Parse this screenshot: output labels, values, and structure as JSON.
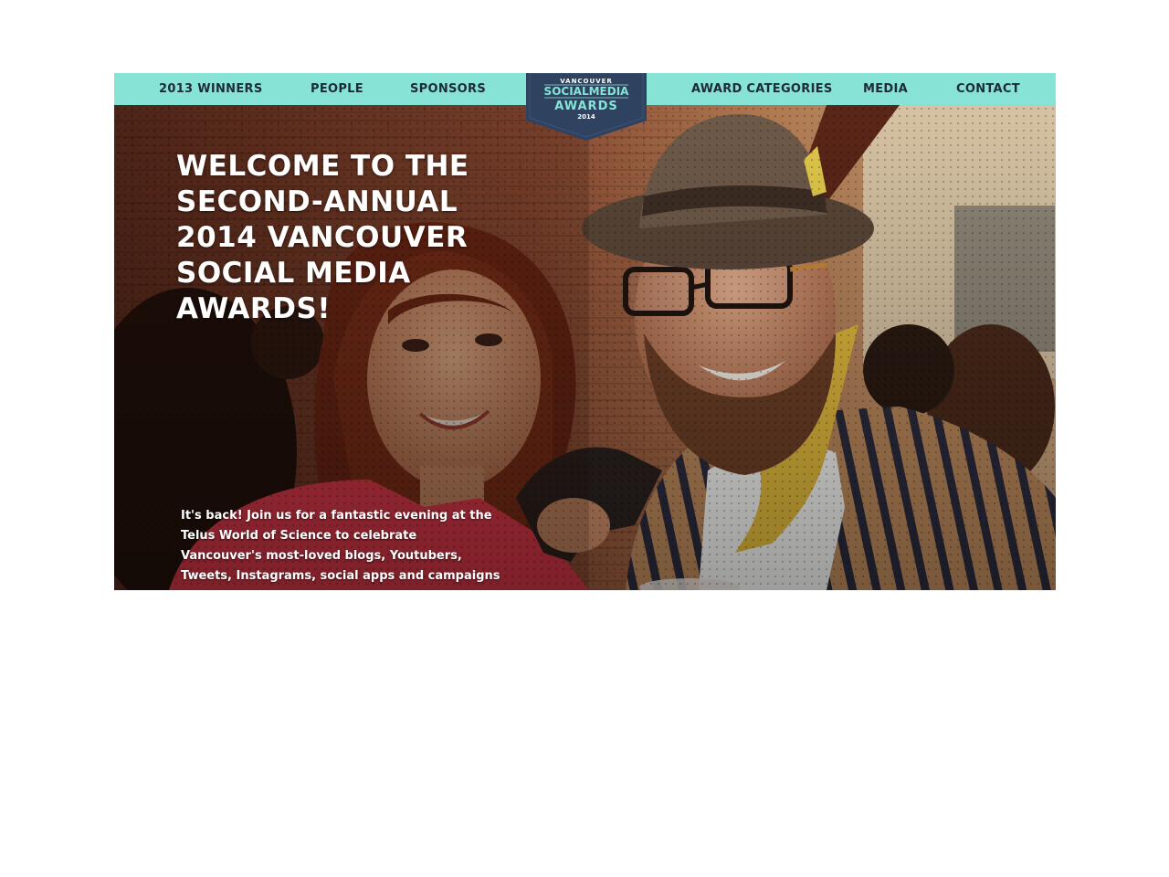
{
  "nav": {
    "left": [
      "2013 WINNERS",
      "PEOPLE",
      "SPONSORS"
    ],
    "right": [
      "AWARD CATEGORIES",
      "MEDIA",
      "CONTACT"
    ]
  },
  "logo": {
    "line1": "VANCOUVER",
    "line2": "SOCIALMEDIA",
    "line3": "AWARDS",
    "line4": "2014"
  },
  "hero": {
    "heading": "WELCOME TO THE SECOND-ANNUAL 2014 VANCOUVER SOCIAL MEDIA AWARDS!",
    "intro": "It's back! Join us for a fantastic evening at the Telus World of Science to celebrate Vancouver's most-loved blogs, Youtubers, Tweets, Instagrams, social apps and campaigns and the creators."
  },
  "colors": {
    "nav_bg": "#86e3d6",
    "nav_text": "#1d2a3a",
    "logo_bg": "#2f4260",
    "logo_accent": "#86e3d6"
  }
}
